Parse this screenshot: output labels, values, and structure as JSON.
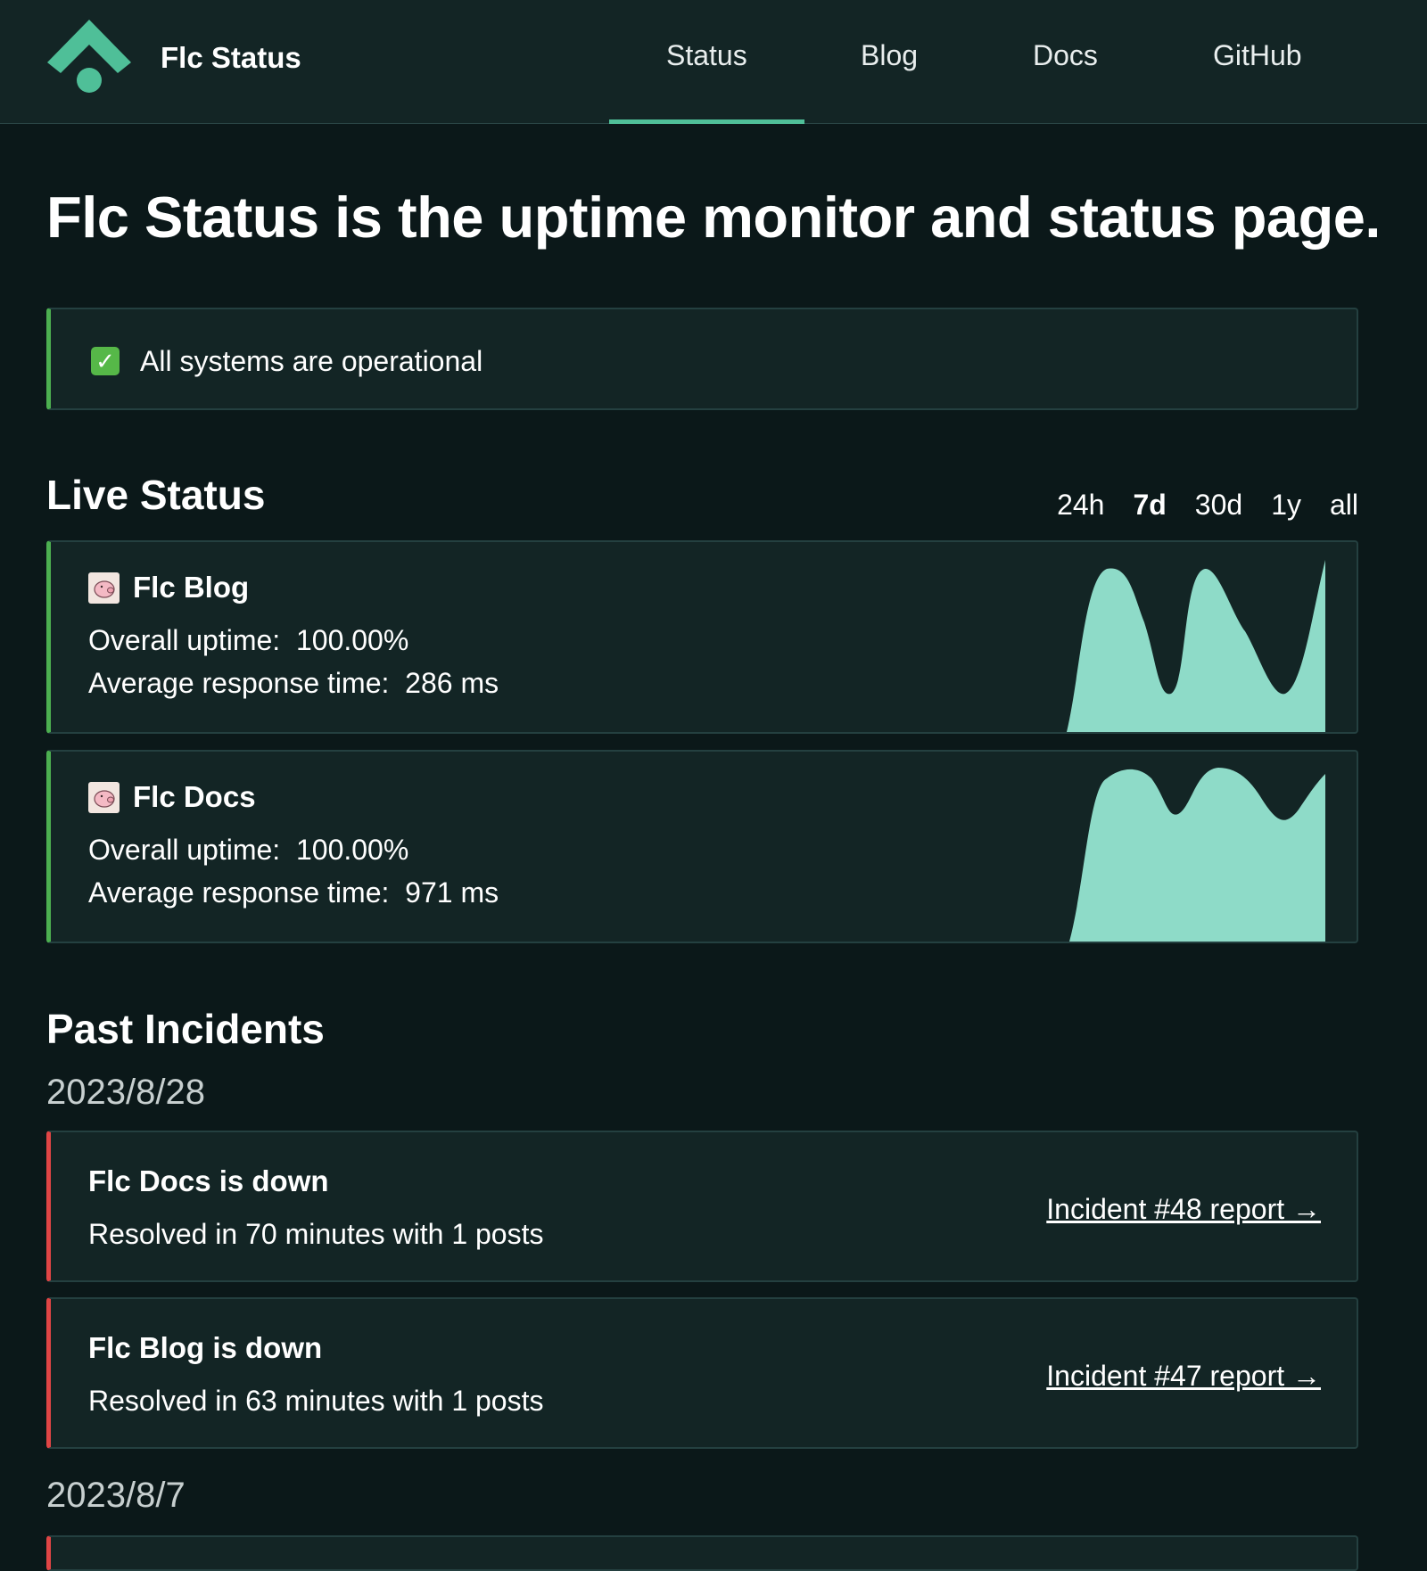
{
  "brand": {
    "name": "Flc Status"
  },
  "nav": [
    {
      "label": "Status",
      "active": true
    },
    {
      "label": "Blog"
    },
    {
      "label": "Docs"
    },
    {
      "label": "GitHub"
    }
  ],
  "hero": {
    "bold": "Flc Status",
    "rest": " is the uptime monitor and status page."
  },
  "banner": {
    "text": "All systems are operational",
    "icon": "check-box-icon"
  },
  "live_status": {
    "title": "Live Status",
    "ranges": [
      "24h",
      "7d",
      "30d",
      "1y",
      "all"
    ],
    "active_range": "7d",
    "uptime_label": "Overall uptime:",
    "response_label": "Average response time:",
    "monitors": [
      {
        "name": "Flc Blog",
        "uptime": "100.00%",
        "response": "286 ms",
        "icon": "pig-favicon-icon"
      },
      {
        "name": "Flc Docs",
        "uptime": "100.00%",
        "response": "971 ms",
        "icon": "pig-favicon-icon"
      }
    ]
  },
  "past_incidents": {
    "title": "Past Incidents",
    "groups": [
      {
        "date": "2023/8/28",
        "items": [
          {
            "title": "Flc Docs is down",
            "summary": "Resolved in 70 minutes with 1 posts",
            "link": "Incident #48 report →"
          },
          {
            "title": "Flc Blog is down",
            "summary": "Resolved in 63 minutes with 1 posts",
            "link": "Incident #47 report →"
          }
        ]
      },
      {
        "date": "2023/8/7",
        "items": []
      }
    ]
  },
  "colors": {
    "background": "#0b1819",
    "panel": "#132525",
    "accent": "#4fbf98",
    "operational": "#4caf50",
    "incident": "#e04545",
    "sparkline": "#8edbc8"
  }
}
